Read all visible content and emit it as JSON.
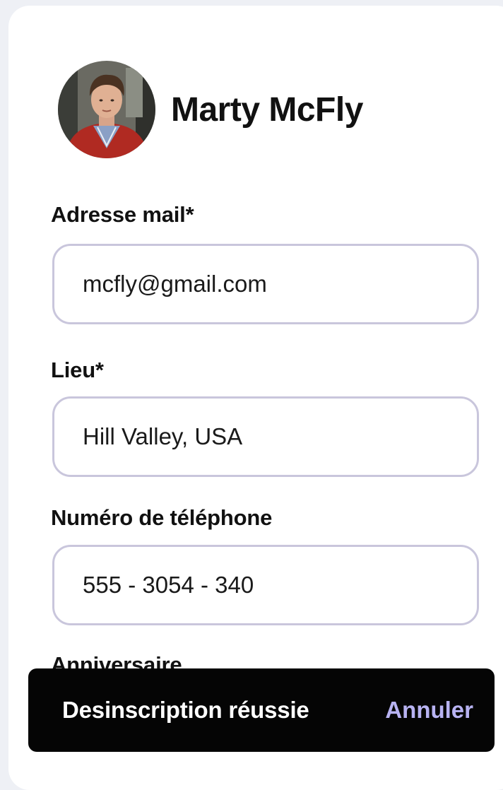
{
  "profile": {
    "name": "Marty McFly",
    "avatar_icon": "user-photo"
  },
  "form": {
    "email": {
      "label": "Adresse mail*",
      "value": "mcfly@gmail.com"
    },
    "location": {
      "label": "Lieu*",
      "value": "Hill Valley, USA"
    },
    "phone": {
      "label": "Numéro de téléphone",
      "value": "555 - 3054 - 340"
    },
    "birthday": {
      "label": "Anniversaire"
    }
  },
  "snackbar": {
    "message": "Desinscription réussie",
    "action_label": "Annuler"
  },
  "colors": {
    "input_border": "#c9c6dc",
    "snackbar_bg": "#050505",
    "snackbar_action": "#b8b3f2"
  }
}
